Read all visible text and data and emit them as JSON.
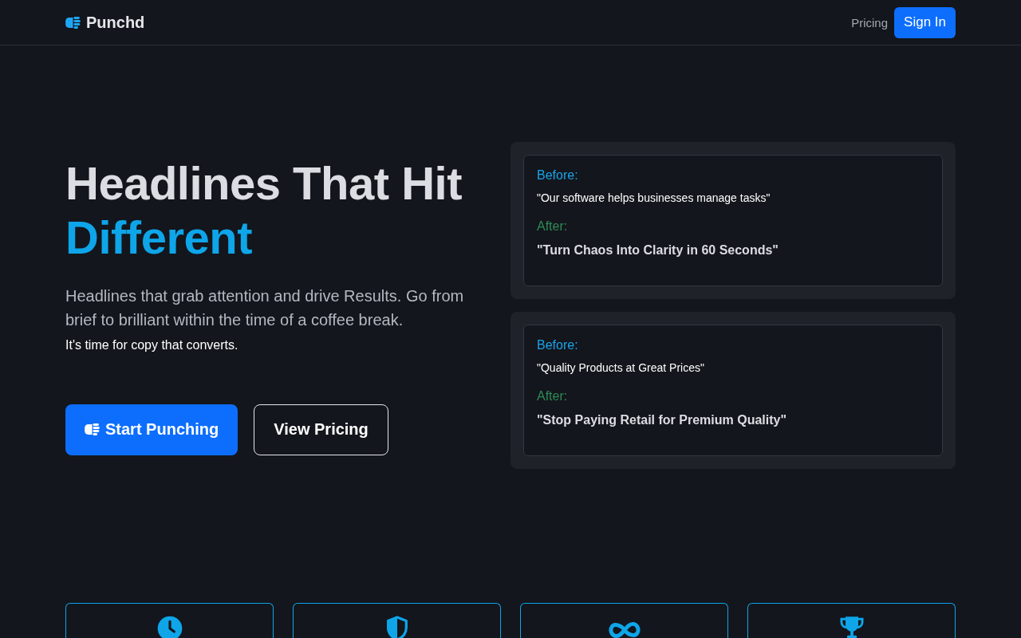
{
  "nav": {
    "brand": "Punchd",
    "links": [
      {
        "label": "Pricing",
        "kind": "link"
      },
      {
        "label": "Sign In",
        "kind": "button"
      }
    ]
  },
  "hero": {
    "headline": "Headlines That Hit",
    "headline_accent": "Different",
    "subtitle": "Headlines that grab attention and drive Results. Go from brief to brilliant within the time of a coffee break.",
    "tagline": "It's time for copy that converts.",
    "buttons": [
      {
        "label": "Start Punching",
        "kind": "primary"
      },
      {
        "label": "View Pricing",
        "kind": "outline"
      }
    ]
  },
  "examples": [
    {
      "before_label": "Before:",
      "before": "\"Our software helps businesses manage tasks\"",
      "after_label": "After:",
      "after": "\"Turn Chaos Into Clarity in 60 Seconds\""
    },
    {
      "before_label": "Before:",
      "before": "\"Quality Products at Great Prices\"",
      "after_label": "After:",
      "after": "\"Stop Paying Retail for Premium Quality\""
    }
  ],
  "features": [
    {
      "kind": "clock"
    },
    {
      "kind": "shield"
    },
    {
      "kind": "infinity"
    },
    {
      "kind": "trophy"
    }
  ]
}
